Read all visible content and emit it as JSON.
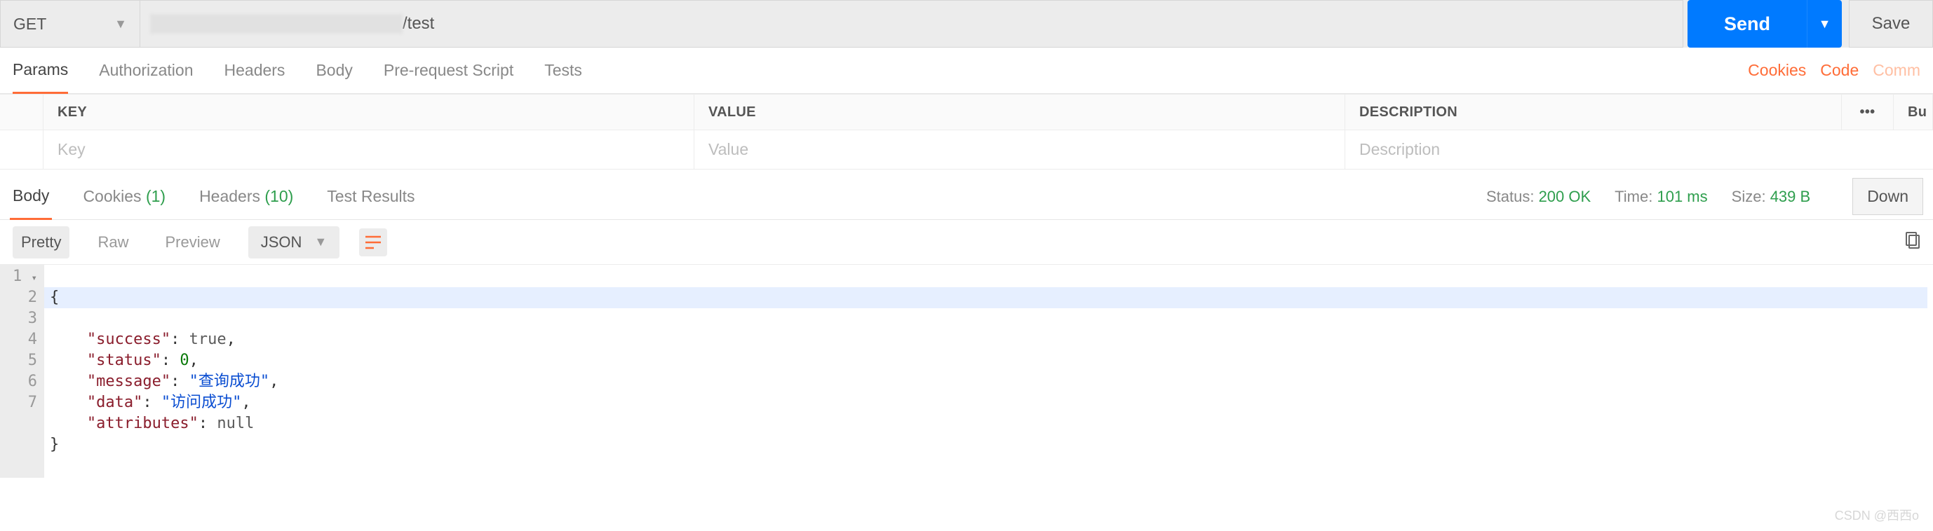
{
  "request": {
    "method": "GET",
    "url_suffix": "/test",
    "send": "Send",
    "save": "Save"
  },
  "request_tabs": {
    "items": [
      "Params",
      "Authorization",
      "Headers",
      "Body",
      "Pre-request Script",
      "Tests"
    ],
    "active": "Params",
    "links": {
      "cookies": "Cookies",
      "code": "Code",
      "comments": "Comm"
    }
  },
  "param_headers": {
    "key": "KEY",
    "value": "VALUE",
    "description": "DESCRIPTION",
    "bulk": "Bu"
  },
  "param_placeholders": {
    "key": "Key",
    "value": "Value",
    "description": "Description"
  },
  "response_tabs": {
    "body": "Body",
    "cookies_label": "Cookies",
    "cookies_count": "(1)",
    "headers_label": "Headers",
    "headers_count": "(10)",
    "tests": "Test Results"
  },
  "response_meta": {
    "status_label": "Status:",
    "status_value": "200 OK",
    "time_label": "Time:",
    "time_value": "101 ms",
    "size_label": "Size:",
    "size_value": "439 B",
    "download": "Down"
  },
  "body_toolbar": {
    "pretty": "Pretty",
    "raw": "Raw",
    "preview": "Preview",
    "format": "JSON"
  },
  "code_lines": [
    "1",
    "2",
    "3",
    "4",
    "5",
    "6",
    "7"
  ],
  "json_body": {
    "l1": "{",
    "k_success": "\"success\"",
    "v_success": "true",
    "k_status": "\"status\"",
    "v_status": "0",
    "k_message": "\"message\"",
    "v_message": "\"查询成功\"",
    "k_data": "\"data\"",
    "v_data": "\"访问成功\"",
    "k_attributes": "\"attributes\"",
    "v_attributes": "null",
    "l7": "}"
  },
  "watermark": "CSDN @西西o"
}
